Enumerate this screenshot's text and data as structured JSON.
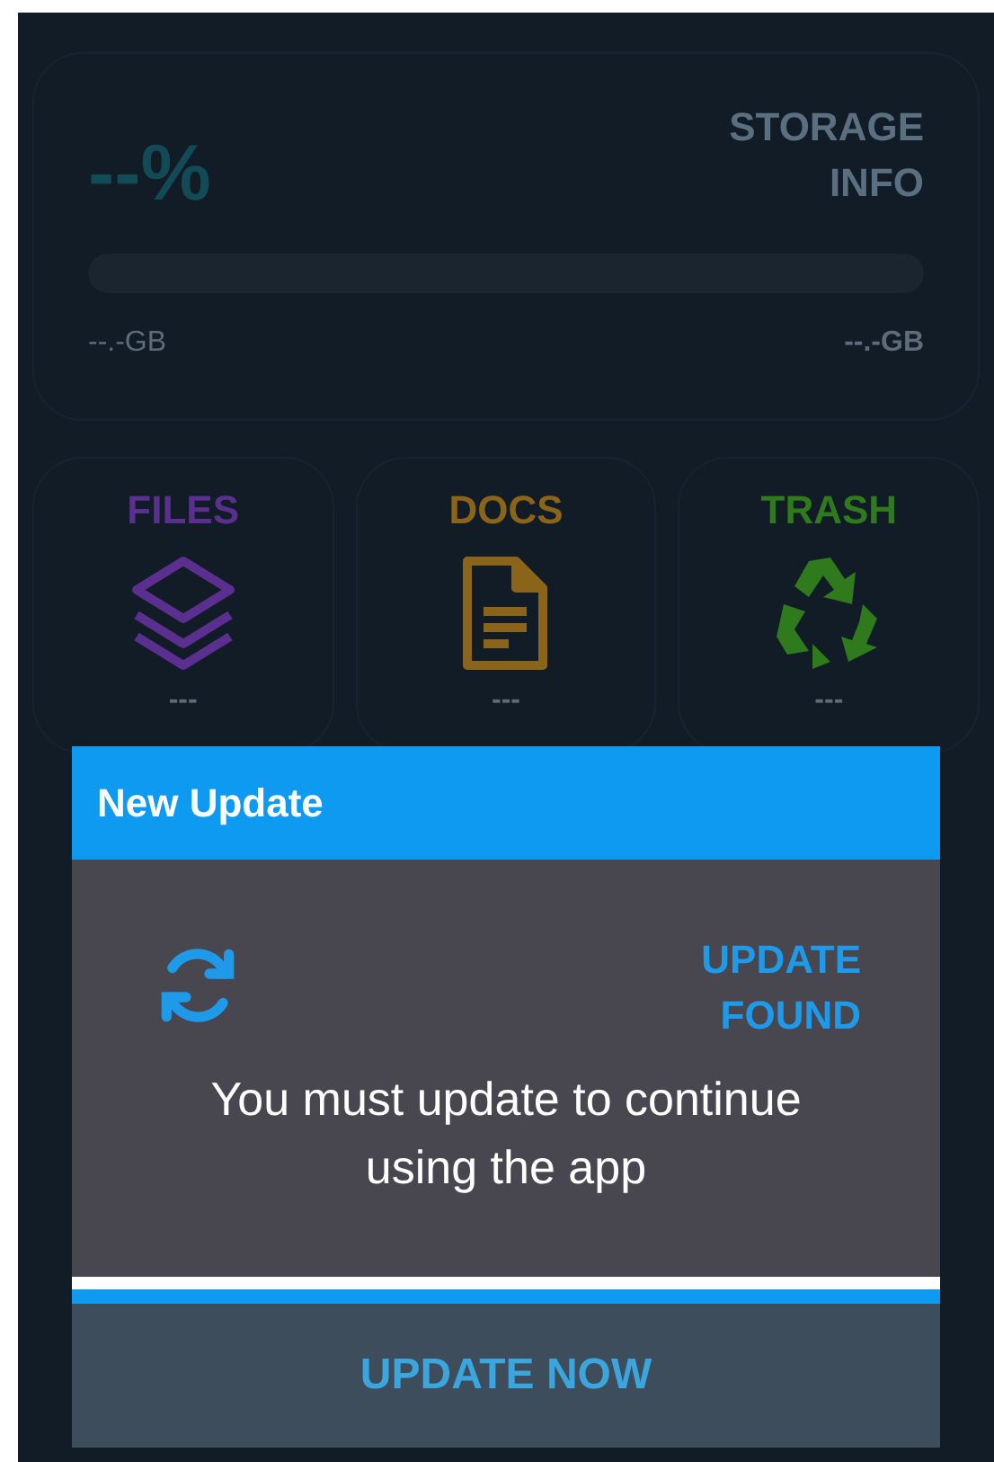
{
  "storage": {
    "percent": "--%",
    "title": "STORAGE INFO",
    "used": "--.-GB",
    "total": "--.-GB"
  },
  "categories": [
    {
      "kind": "files",
      "label": "FILES",
      "count": "---",
      "color": "#5b2f8f"
    },
    {
      "kind": "docs",
      "label": "DOCS",
      "count": "---",
      "color": "#8a6418"
    },
    {
      "kind": "trash",
      "label": "TRASH",
      "count": "---",
      "color": "#2f7a1c"
    }
  ],
  "dialog": {
    "title": "New Update",
    "status": "UPDATE FOUND",
    "message": "You must update to continue using the app",
    "button": "UPDATE NOW"
  }
}
